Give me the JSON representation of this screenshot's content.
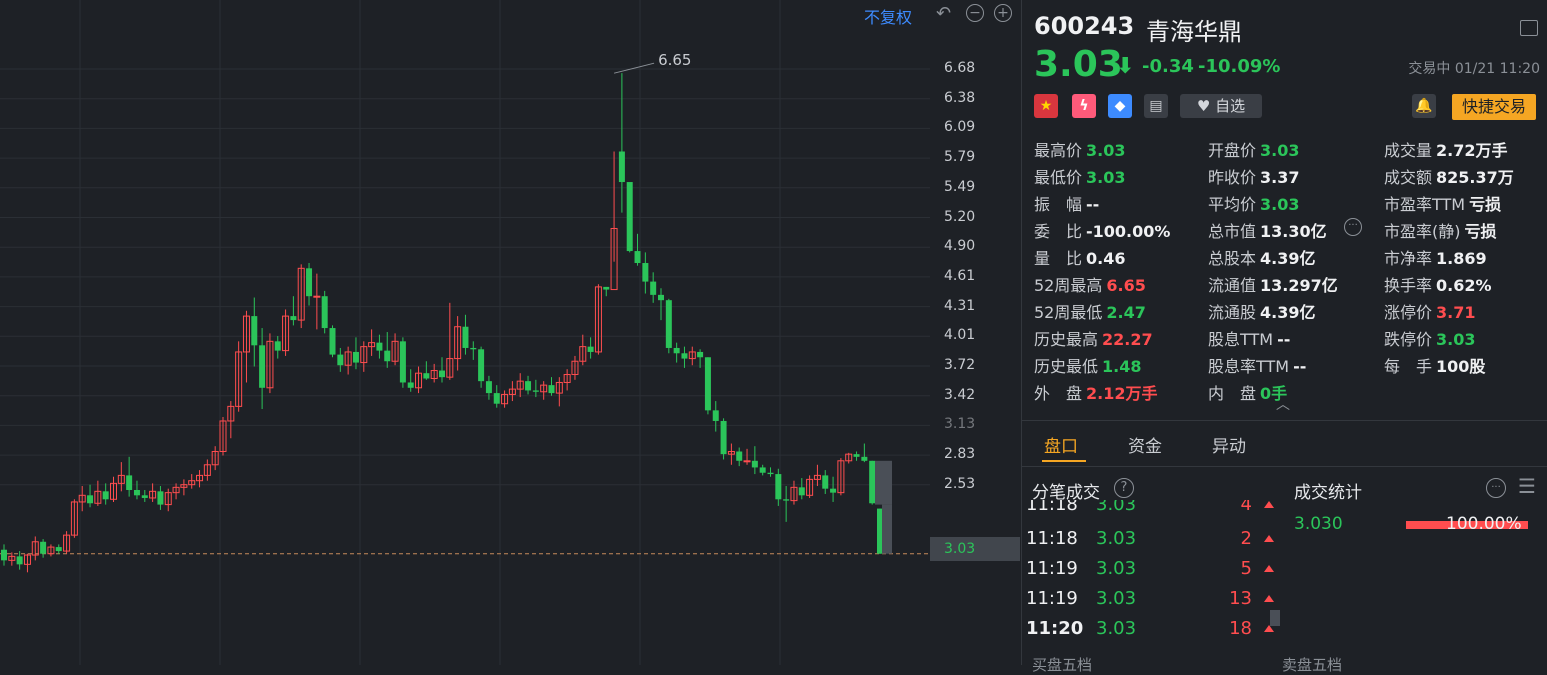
{
  "chart": {
    "adj_label": "不复权",
    "y_axis": [
      "6.68",
      "6.38",
      "6.09",
      "5.79",
      "5.49",
      "5.20",
      "4.90",
      "4.61",
      "4.31",
      "4.01",
      "3.72",
      "3.42",
      "3.13",
      "2.83",
      "2.53"
    ],
    "current_price_tag": "3.03",
    "high_marker": "6.65",
    "colors": {
      "up": "#ff4d4f",
      "down": "#2bc55a",
      "grid": "#2b2f35",
      "bg": "#1e2126"
    }
  },
  "chart_data": {
    "type": "candlestick",
    "ylim": [
      2.38,
      6.9
    ],
    "candles": [
      {
        "o": 3.06,
        "h": 3.1,
        "l": 2.94,
        "c": 2.98
      },
      {
        "o": 2.98,
        "h": 3.04,
        "l": 2.94,
        "c": 3.01
      },
      {
        "o": 3.01,
        "h": 3.05,
        "l": 2.91,
        "c": 2.95
      },
      {
        "o": 2.95,
        "h": 3.03,
        "l": 2.89,
        "c": 3.02
      },
      {
        "o": 3.02,
        "h": 3.16,
        "l": 2.98,
        "c": 3.12
      },
      {
        "o": 3.12,
        "h": 3.14,
        "l": 3.0,
        "c": 3.03
      },
      {
        "o": 3.03,
        "h": 3.1,
        "l": 3.01,
        "c": 3.08
      },
      {
        "o": 3.08,
        "h": 3.1,
        "l": 3.03,
        "c": 3.05
      },
      {
        "o": 3.05,
        "h": 3.2,
        "l": 3.03,
        "c": 3.17
      },
      {
        "o": 3.17,
        "h": 3.44,
        "l": 3.15,
        "c": 3.42
      },
      {
        "o": 3.42,
        "h": 3.54,
        "l": 3.35,
        "c": 3.47
      },
      {
        "o": 3.47,
        "h": 3.55,
        "l": 3.38,
        "c": 3.41
      },
      {
        "o": 3.41,
        "h": 3.58,
        "l": 3.39,
        "c": 3.5
      },
      {
        "o": 3.5,
        "h": 3.56,
        "l": 3.4,
        "c": 3.44
      },
      {
        "o": 3.44,
        "h": 3.61,
        "l": 3.42,
        "c": 3.56
      },
      {
        "o": 3.56,
        "h": 3.72,
        "l": 3.5,
        "c": 3.62
      },
      {
        "o": 3.62,
        "h": 3.76,
        "l": 3.46,
        "c": 3.51
      },
      {
        "o": 3.51,
        "h": 3.58,
        "l": 3.44,
        "c": 3.47
      },
      {
        "o": 3.47,
        "h": 3.51,
        "l": 3.42,
        "c": 3.45
      },
      {
        "o": 3.45,
        "h": 3.56,
        "l": 3.42,
        "c": 3.5
      },
      {
        "o": 3.5,
        "h": 3.54,
        "l": 3.36,
        "c": 3.4
      },
      {
        "o": 3.4,
        "h": 3.52,
        "l": 3.35,
        "c": 3.49
      },
      {
        "o": 3.49,
        "h": 3.56,
        "l": 3.44,
        "c": 3.53
      },
      {
        "o": 3.53,
        "h": 3.59,
        "l": 3.47,
        "c": 3.55
      },
      {
        "o": 3.55,
        "h": 3.63,
        "l": 3.52,
        "c": 3.58
      },
      {
        "o": 3.58,
        "h": 3.66,
        "l": 3.53,
        "c": 3.62
      },
      {
        "o": 3.62,
        "h": 3.74,
        "l": 3.58,
        "c": 3.7
      },
      {
        "o": 3.7,
        "h": 3.84,
        "l": 3.66,
        "c": 3.8
      },
      {
        "o": 3.8,
        "h": 4.06,
        "l": 3.77,
        "c": 4.03
      },
      {
        "o": 4.03,
        "h": 4.18,
        "l": 3.9,
        "c": 4.14
      },
      {
        "o": 4.14,
        "h": 4.63,
        "l": 4.1,
        "c": 4.55
      },
      {
        "o": 4.55,
        "h": 4.86,
        "l": 4.32,
        "c": 4.82
      },
      {
        "o": 4.82,
        "h": 4.96,
        "l": 4.44,
        "c": 4.6
      },
      {
        "o": 4.6,
        "h": 4.73,
        "l": 4.12,
        "c": 4.28
      },
      {
        "o": 4.28,
        "h": 4.69,
        "l": 4.24,
        "c": 4.63
      },
      {
        "o": 4.63,
        "h": 4.67,
        "l": 4.5,
        "c": 4.56
      },
      {
        "o": 4.56,
        "h": 4.87,
        "l": 4.52,
        "c": 4.82
      },
      {
        "o": 4.82,
        "h": 4.97,
        "l": 4.75,
        "c": 4.79
      },
      {
        "o": 4.79,
        "h": 5.21,
        "l": 4.73,
        "c": 5.18
      },
      {
        "o": 5.18,
        "h": 5.22,
        "l": 4.9,
        "c": 4.97
      },
      {
        "o": 4.97,
        "h": 5.14,
        "l": 4.72,
        "c": 4.97
      },
      {
        "o": 4.97,
        "h": 5.01,
        "l": 4.69,
        "c": 4.73
      },
      {
        "o": 4.73,
        "h": 4.75,
        "l": 4.51,
        "c": 4.53
      },
      {
        "o": 4.53,
        "h": 4.58,
        "l": 4.4,
        "c": 4.45
      },
      {
        "o": 4.45,
        "h": 4.59,
        "l": 4.38,
        "c": 4.55
      },
      {
        "o": 4.55,
        "h": 4.66,
        "l": 4.42,
        "c": 4.47
      },
      {
        "o": 4.47,
        "h": 4.63,
        "l": 4.4,
        "c": 4.59
      },
      {
        "o": 4.59,
        "h": 4.72,
        "l": 4.52,
        "c": 4.62
      },
      {
        "o": 4.62,
        "h": 4.68,
        "l": 4.5,
        "c": 4.56
      },
      {
        "o": 4.56,
        "h": 4.7,
        "l": 4.43,
        "c": 4.48
      },
      {
        "o": 4.48,
        "h": 4.69,
        "l": 4.45,
        "c": 4.63
      },
      {
        "o": 4.63,
        "h": 4.66,
        "l": 4.28,
        "c": 4.32
      },
      {
        "o": 4.32,
        "h": 4.42,
        "l": 4.25,
        "c": 4.28
      },
      {
        "o": 4.28,
        "h": 4.44,
        "l": 4.24,
        "c": 4.39
      },
      {
        "o": 4.39,
        "h": 4.48,
        "l": 4.34,
        "c": 4.35
      },
      {
        "o": 4.35,
        "h": 4.46,
        "l": 4.32,
        "c": 4.41
      },
      {
        "o": 4.41,
        "h": 4.51,
        "l": 4.32,
        "c": 4.36
      },
      {
        "o": 4.36,
        "h": 4.92,
        "l": 4.34,
        "c": 4.5
      },
      {
        "o": 4.5,
        "h": 4.82,
        "l": 4.41,
        "c": 4.74
      },
      {
        "o": 4.74,
        "h": 4.83,
        "l": 4.53,
        "c": 4.58
      },
      {
        "o": 4.58,
        "h": 4.63,
        "l": 4.49,
        "c": 4.57
      },
      {
        "o": 4.57,
        "h": 4.59,
        "l": 4.28,
        "c": 4.33
      },
      {
        "o": 4.33,
        "h": 4.37,
        "l": 4.19,
        "c": 4.24
      },
      {
        "o": 4.24,
        "h": 4.3,
        "l": 4.13,
        "c": 4.16
      },
      {
        "o": 4.16,
        "h": 4.26,
        "l": 4.13,
        "c": 4.23
      },
      {
        "o": 4.23,
        "h": 4.33,
        "l": 4.18,
        "c": 4.27
      },
      {
        "o": 4.27,
        "h": 4.39,
        "l": 4.21,
        "c": 4.33
      },
      {
        "o": 4.33,
        "h": 4.37,
        "l": 4.23,
        "c": 4.26
      },
      {
        "o": 4.26,
        "h": 4.34,
        "l": 4.21,
        "c": 4.25
      },
      {
        "o": 4.25,
        "h": 4.33,
        "l": 4.19,
        "c": 4.3
      },
      {
        "o": 4.3,
        "h": 4.36,
        "l": 4.22,
        "c": 4.24
      },
      {
        "o": 4.24,
        "h": 4.36,
        "l": 4.14,
        "c": 4.32
      },
      {
        "o": 4.32,
        "h": 4.42,
        "l": 4.26,
        "c": 4.38
      },
      {
        "o": 4.38,
        "h": 4.52,
        "l": 4.34,
        "c": 4.48
      },
      {
        "o": 4.48,
        "h": 4.68,
        "l": 4.45,
        "c": 4.59
      },
      {
        "o": 4.59,
        "h": 4.66,
        "l": 4.5,
        "c": 4.55
      },
      {
        "o": 4.55,
        "h": 5.06,
        "l": 4.53,
        "c": 5.04
      },
      {
        "o": 5.04,
        "h": 5.04,
        "l": 4.97,
        "c": 5.02
      },
      {
        "o": 5.02,
        "h": 6.06,
        "l": 5.23,
        "c": 5.48
      },
      {
        "o": 6.06,
        "h": 6.65,
        "l": 5.6,
        "c": 5.83
      },
      {
        "o": 5.83,
        "h": 5.58,
        "l": 5.3,
        "c": 5.31
      },
      {
        "o": 5.31,
        "h": 5.44,
        "l": 5.2,
        "c": 5.22
      },
      {
        "o": 5.22,
        "h": 5.3,
        "l": 4.99,
        "c": 5.08
      },
      {
        "o": 5.08,
        "h": 5.15,
        "l": 4.92,
        "c": 4.98
      },
      {
        "o": 4.98,
        "h": 5.03,
        "l": 4.79,
        "c": 4.94
      },
      {
        "o": 4.94,
        "h": 4.95,
        "l": 4.54,
        "c": 4.58
      },
      {
        "o": 4.58,
        "h": 4.62,
        "l": 4.47,
        "c": 4.54
      },
      {
        "o": 4.54,
        "h": 4.59,
        "l": 4.43,
        "c": 4.5
      },
      {
        "o": 4.5,
        "h": 4.59,
        "l": 4.45,
        "c": 4.55
      },
      {
        "o": 4.55,
        "h": 4.57,
        "l": 4.43,
        "c": 4.51
      },
      {
        "o": 4.51,
        "h": 4.51,
        "l": 4.08,
        "c": 4.11
      },
      {
        "o": 4.11,
        "h": 4.18,
        "l": 3.95,
        "c": 4.03
      },
      {
        "o": 4.03,
        "h": 4.05,
        "l": 3.74,
        "c": 3.78
      },
      {
        "o": 3.78,
        "h": 3.86,
        "l": 3.7,
        "c": 3.8
      },
      {
        "o": 3.8,
        "h": 3.83,
        "l": 3.69,
        "c": 3.73
      },
      {
        "o": 3.73,
        "h": 3.82,
        "l": 3.7,
        "c": 3.73
      },
      {
        "o": 3.73,
        "h": 3.84,
        "l": 3.63,
        "c": 3.68
      },
      {
        "o": 3.68,
        "h": 3.7,
        "l": 3.62,
        "c": 3.64
      },
      {
        "o": 3.64,
        "h": 3.68,
        "l": 3.61,
        "c": 3.63
      },
      {
        "o": 3.63,
        "h": 3.67,
        "l": 3.39,
        "c": 3.44
      },
      {
        "o": 3.44,
        "h": 3.54,
        "l": 3.27,
        "c": 3.43
      },
      {
        "o": 3.43,
        "h": 3.58,
        "l": 3.4,
        "c": 3.53
      },
      {
        "o": 3.53,
        "h": 3.6,
        "l": 3.44,
        "c": 3.47
      },
      {
        "o": 3.47,
        "h": 3.62,
        "l": 3.45,
        "c": 3.59
      },
      {
        "o": 3.59,
        "h": 3.7,
        "l": 3.54,
        "c": 3.62
      },
      {
        "o": 3.62,
        "h": 3.66,
        "l": 3.48,
        "c": 3.52
      },
      {
        "o": 3.52,
        "h": 3.61,
        "l": 3.42,
        "c": 3.49
      },
      {
        "o": 3.49,
        "h": 3.75,
        "l": 3.47,
        "c": 3.73
      },
      {
        "o": 3.73,
        "h": 3.79,
        "l": 3.71,
        "c": 3.78
      },
      {
        "o": 3.78,
        "h": 3.8,
        "l": 3.73,
        "c": 3.76
      },
      {
        "o": 3.76,
        "h": 3.86,
        "l": 3.72,
        "c": 3.73
      },
      {
        "o": 3.73,
        "h": 3.73,
        "l": 3.4,
        "c": 3.41
      },
      {
        "o": 3.37,
        "h": 3.37,
        "l": 3.03,
        "c": 3.03
      }
    ]
  },
  "header": {
    "code": "600243",
    "name": "青海华鼎",
    "price": "3.03",
    "change": "-0.34",
    "change_pct": "-10.09%",
    "status_time": "交易中 01/21 11:20",
    "fav_label": "自选",
    "quick_trade": "快捷交易"
  },
  "stats": {
    "col1": [
      {
        "label": "最高价",
        "value": "3.03",
        "color": "green"
      },
      {
        "label": "最低价",
        "value": "3.03",
        "color": "green"
      },
      {
        "label": "振　幅",
        "value": "--",
        "color": "white"
      },
      {
        "label": "委　比",
        "value": "-100.00%",
        "color": "white"
      },
      {
        "label": "量　比",
        "value": "0.46",
        "color": "white"
      },
      {
        "label": "52周最高",
        "value": "6.65",
        "color": "red"
      },
      {
        "label": "52周最低",
        "value": "2.47",
        "color": "green"
      },
      {
        "label": "历史最高",
        "value": "22.27",
        "color": "red"
      },
      {
        "label": "历史最低",
        "value": "1.48",
        "color": "green"
      },
      {
        "label": "外　盘",
        "value": "2.12万手",
        "color": "red"
      }
    ],
    "col2": [
      {
        "label": "开盘价",
        "value": "3.03",
        "color": "green"
      },
      {
        "label": "昨收价",
        "value": "3.37",
        "color": "white"
      },
      {
        "label": "平均价",
        "value": "3.03",
        "color": "green"
      },
      {
        "label": "总市值",
        "value": "13.30亿",
        "color": "white"
      },
      {
        "label": "总股本",
        "value": "4.39亿",
        "color": "white"
      },
      {
        "label": "流通值",
        "value": "13.297亿",
        "color": "white"
      },
      {
        "label": "流通股",
        "value": "4.39亿",
        "color": "white"
      },
      {
        "label": "股息TTM",
        "value": "--",
        "color": "white"
      },
      {
        "label": "股息率TTM",
        "value": "--",
        "color": "white"
      },
      {
        "label": "内　盘",
        "value": "0手",
        "color": "green"
      }
    ],
    "col3": [
      {
        "label": "成交量",
        "value": "2.72万手",
        "color": "white"
      },
      {
        "label": "成交额",
        "value": "825.37万",
        "color": "white"
      },
      {
        "label": "市盈率TTM",
        "value": "亏损",
        "color": "white"
      },
      {
        "label": "市盈率(静)",
        "value": "亏损",
        "color": "white"
      },
      {
        "label": "市净率",
        "value": "1.869",
        "color": "white"
      },
      {
        "label": "换手率",
        "value": "0.62%",
        "color": "white"
      },
      {
        "label": "涨停价",
        "value": "3.71",
        "color": "red"
      },
      {
        "label": "跌停价",
        "value": "3.03",
        "color": "green"
      },
      {
        "label": "每　手",
        "value": "100股",
        "color": "white"
      }
    ]
  },
  "tabs": [
    "盘口",
    "资金",
    "异动"
  ],
  "ticks_title": "分笔成交",
  "ticks": [
    {
      "time": "11:18",
      "price": "3.03",
      "vol": "2"
    },
    {
      "time": "11:19",
      "price": "3.03",
      "vol": "5"
    },
    {
      "time": "11:19",
      "price": "3.03",
      "vol": "13"
    },
    {
      "time": "11:20",
      "price": "3.03",
      "vol": "18"
    }
  ],
  "tick_partial": {
    "time": "11:18",
    "price": "3.03",
    "vol": "4"
  },
  "deal_stats": {
    "title": "成交统计",
    "price": "3.030",
    "pct": "100.00%"
  },
  "footer_hints": [
    "买盘五档",
    "卖盘五档"
  ]
}
